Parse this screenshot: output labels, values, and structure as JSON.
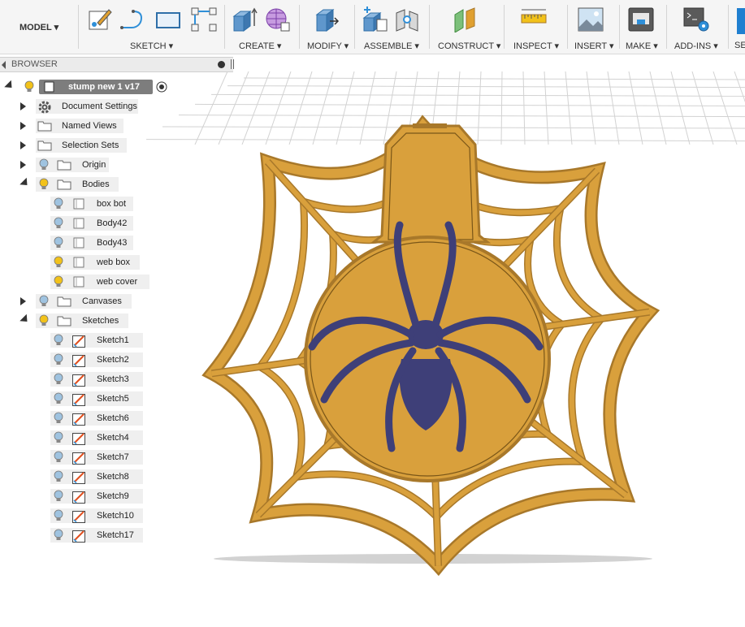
{
  "toolbar": {
    "workspace": "MODEL ▾",
    "groups": [
      {
        "label": "SKETCH ▾"
      },
      {
        "label": "CREATE ▾"
      },
      {
        "label": "MODIFY ▾"
      },
      {
        "label": "ASSEMBLE ▾"
      },
      {
        "label": "CONSTRUCT ▾"
      },
      {
        "label": "INSPECT ▾"
      },
      {
        "label": "INSERT ▾"
      },
      {
        "label": "MAKE ▾"
      },
      {
        "label": "ADD-INS ▾"
      },
      {
        "label": "SE"
      }
    ]
  },
  "browser": {
    "title": "BROWSER",
    "root": "stump new 1 v17",
    "items": [
      {
        "label": "Document Settings",
        "icon": "gear-icon"
      },
      {
        "label": "Named Views",
        "icon": "folder-icon"
      },
      {
        "label": "Selection Sets",
        "icon": "folder-icon"
      },
      {
        "label": "Origin",
        "icon": "folder-icon"
      },
      {
        "label": "Bodies",
        "icon": "folder-icon"
      },
      {
        "label": "box bot",
        "icon": "body-icon"
      },
      {
        "label": "Body42",
        "icon": "body-icon"
      },
      {
        "label": "Body43",
        "icon": "body-icon"
      },
      {
        "label": "web box",
        "icon": "body-icon"
      },
      {
        "label": "web cover",
        "icon": "body-icon"
      },
      {
        "label": "Canvases",
        "icon": "folder-icon"
      },
      {
        "label": "Sketches",
        "icon": "folder-icon"
      },
      {
        "label": "Sketch1",
        "icon": "sketch-icon"
      },
      {
        "label": "Sketch2",
        "icon": "sketch-icon"
      },
      {
        "label": "Sketch3",
        "icon": "sketch-icon"
      },
      {
        "label": "Sketch5",
        "icon": "sketch-icon"
      },
      {
        "label": "Sketch6",
        "icon": "sketch-icon"
      },
      {
        "label": "Sketch4",
        "icon": "sketch-icon"
      },
      {
        "label": "Sketch7",
        "icon": "sketch-icon"
      },
      {
        "label": "Sketch8",
        "icon": "sketch-icon"
      },
      {
        "label": "Sketch9",
        "icon": "sketch-icon"
      },
      {
        "label": "Sketch10",
        "icon": "sketch-icon"
      },
      {
        "label": "Sketch17",
        "icon": "sketch-icon"
      }
    ]
  },
  "colors": {
    "web": "#d9a03c",
    "web_edge": "#a8782a",
    "spider": "#3e3f78",
    "bulb_on": "#f2c21a",
    "bulb_off": "#9fc3e0"
  }
}
